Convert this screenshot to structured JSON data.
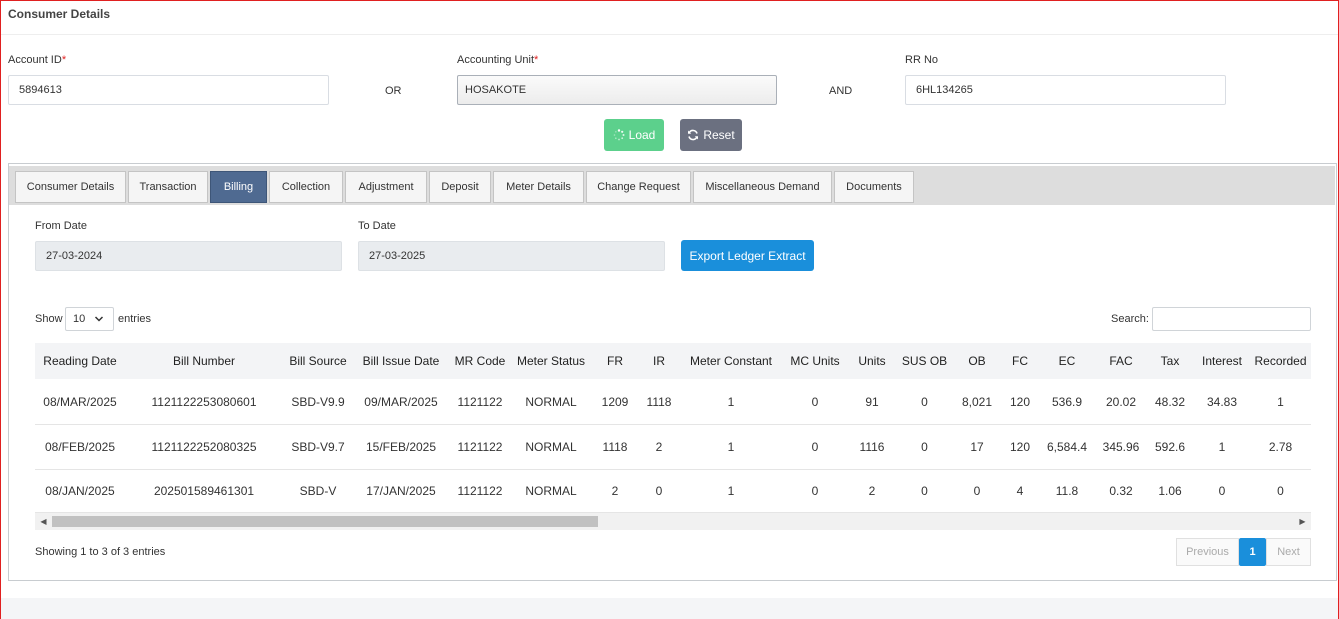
{
  "panel": {
    "title": "Consumer Details"
  },
  "form": {
    "account_id_label": "Account ID",
    "account_id_value": "5894613",
    "or_label": "OR",
    "accounting_unit_label": "Accounting Unit",
    "accounting_unit_value": "HOSAKOTE",
    "and_label": "AND",
    "rr_no_label": "RR No",
    "rr_no_value": "6HL134265",
    "required_mark": "*",
    "load_label": "Load",
    "reset_label": "Reset"
  },
  "tabs": [
    {
      "label": "Consumer Details"
    },
    {
      "label": "Transaction"
    },
    {
      "label": "Billing"
    },
    {
      "label": "Collection"
    },
    {
      "label": "Adjustment"
    },
    {
      "label": "Deposit"
    },
    {
      "label": "Meter Details"
    },
    {
      "label": "Change Request"
    },
    {
      "label": "Miscellaneous Demand"
    },
    {
      "label": "Documents"
    }
  ],
  "active_tab": "Billing",
  "billing": {
    "from_date_label": "From Date",
    "from_date_value": "27-03-2024",
    "to_date_label": "To Date",
    "to_date_value": "27-03-2025",
    "export_label": "Export Ledger Extract"
  },
  "table_controls": {
    "show_label": "Show",
    "page_size": "10",
    "entries_label": "entries",
    "search_label": "Search:"
  },
  "table": {
    "columns": [
      "Reading Date",
      "Bill Number",
      "Bill Source",
      "Bill Issue Date",
      "MR Code",
      "Meter Status",
      "FR",
      "IR",
      "Meter Constant",
      "MC Units",
      "Units",
      "SUS OB",
      "OB",
      "FC",
      "EC",
      "FAC",
      "Tax",
      "Interest",
      "Recorded"
    ],
    "rows": [
      [
        "08/MAR/2025",
        "1121122253080601",
        "SBD-V9.9",
        "09/MAR/2025",
        "1121122",
        "NORMAL",
        "1209",
        "1118",
        "1",
        "0",
        "91",
        "0",
        "8,021",
        "120",
        "536.9",
        "20.02",
        "48.32",
        "34.83",
        "1"
      ],
      [
        "08/FEB/2025",
        "1121122252080325",
        "SBD-V9.7",
        "15/FEB/2025",
        "1121122",
        "NORMAL",
        "1118",
        "2",
        "1",
        "0",
        "1116",
        "0",
        "17",
        "120",
        "6,584.4",
        "345.96",
        "592.6",
        "1",
        "2.78"
      ],
      [
        "08/JAN/2025",
        "202501589461301",
        "SBD-V",
        "17/JAN/2025",
        "1121122",
        "NORMAL",
        "2",
        "0",
        "1",
        "0",
        "2",
        "0",
        "0",
        "4",
        "11.8",
        "0.32",
        "1.06",
        "0",
        "0"
      ]
    ]
  },
  "footer": {
    "info": "Showing 1 to 3 of 3 entries",
    "previous_label": "Previous",
    "current_page": "1",
    "next_label": "Next"
  },
  "colors": {
    "load_button": "#5cd08c",
    "reset_button": "#6b7080",
    "export_button": "#1a8fdb",
    "active_tab": "#4f6a91",
    "required_mark": "#e02020"
  },
  "icons": {
    "load": "spinner-icon",
    "reset": "refresh-icon",
    "page_size_select": "chevron-down-icon",
    "scroll_left": "triangle-left-icon",
    "scroll_right": "triangle-right-icon"
  }
}
